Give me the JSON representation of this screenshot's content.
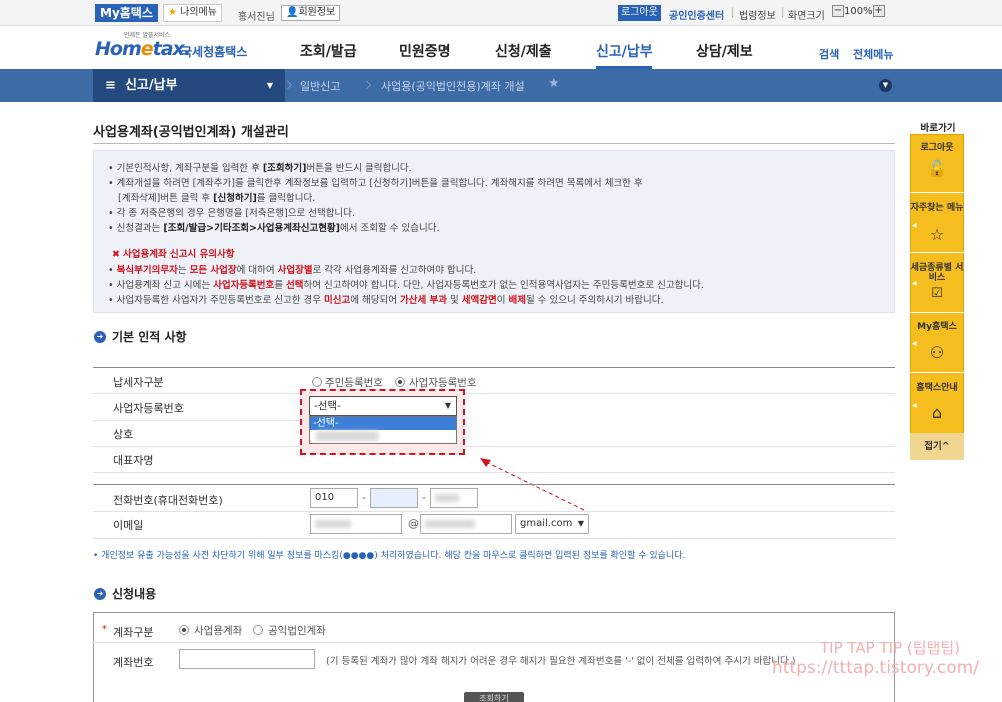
{
  "topbar": {
    "my_hometax": "My홈택스",
    "my_menu": "나의메뉴",
    "user_name": "홍서진님",
    "user_info": "회원정보",
    "logout": "로그아웃",
    "cert_center": "공인인증센터",
    "law_info": "법령정보",
    "screen_size": "화면크기",
    "zoom": "100%"
  },
  "header": {
    "logo_sub": "언제든 알뜰서비스",
    "logo_main": "Hom",
    "logo_e": "e",
    "logo_tax": "tax.",
    "logo_nts": "국세청홈택스",
    "gnav": [
      "조회/발급",
      "민원증명",
      "신청/제출",
      "신고/납부",
      "상담/제보"
    ],
    "search": "검색",
    "all_menu": "전체메뉴"
  },
  "nav": {
    "section": "신고/납부",
    "crumbs": [
      "일반신고",
      "사업용(공익법인전용)계좌 개설"
    ]
  },
  "page": {
    "title": "사업용계좌(공익법인계좌) 개설관리"
  },
  "notice": {
    "l1a": "기본인적사항, 계좌구분을 입력한 후 ",
    "l1b": "[조회하기]",
    "l1c": "버튼을 반드시 클릭합니다.",
    "l2": "계좌개설을 하려면 [계좌추가]를 클릭한후 계좌정보를 입력하고 [신청하기]버튼을 클릭합니다. 계좌해지를 하려면 목록에서 체크한 후",
    "l3a": "[계좌삭제]버튼 클릭 후 ",
    "l3b": "[신청하기]",
    "l3c": "를 클릭합니다.",
    "l4": "각 종 저축은행의 경우 은행명을 [저축은행]으로 선택합니다.",
    "l5a": "신청결과는 ",
    "l5b": "[조회/발급>기타조회>사업용계좌신고현황]",
    "l5c": "에서 조회할 수 있습니다.",
    "w_title": "사업용계좌 신고시 유의사항",
    "w1a": "복식부기의무자",
    "w1b": "는 ",
    "w1c": "모든 사업장",
    "w1d": "에 대하여 ",
    "w1e": "사업장별",
    "w1f": "로 각각 사업용계좌를 신고하여야 합니다.",
    "w2a": "사업용계좌 신고 시에는 ",
    "w2b": "사업자등록번호",
    "w2c": "를 ",
    "w2d": "선택",
    "w2e": "하여 신고하여야 합니다. 다만, 사업자등록번호가 없는 인적용역사업자는 주민등록번호로 신고합니다.",
    "w3a": "사업자등록한 사업자가 주민등록번호로 신고한 경우 ",
    "w3b": "미신고",
    "w3c": "에 해당되어 ",
    "w3d": "가산세 부과",
    "w3e": " 및 ",
    "w3f": "세액감면",
    "w3g": "이 ",
    "w3h": "배제",
    "w3i": "될 수 있으니 주의하시기 바랍니다."
  },
  "basic": {
    "title": "기본 인적 사항",
    "taxpayer_type_label": "납세자구분",
    "opt_resident": "주민등록번호",
    "opt_business": "사업자등록번호",
    "bizno_label": "사업자등록번호",
    "bizno_selected": "-선택-",
    "bizno_options": [
      "-선택-"
    ],
    "company_label": "상호",
    "ceo_label": "대표자명",
    "phone_label": "전화번호(휴대전화번호)",
    "phone1": "010",
    "dash": "-",
    "email_label": "이메일",
    "at": "@",
    "email_domain": "gmail.com",
    "mask_note": "• 개인정보 유출 가능성을 사전 차단하기 위해 일부 정보를 마스킹(●●●●) 처리하였습니다. 해당 칸을 마우스로 클릭하면 입력된 정보를 확인할 수 있습니다."
  },
  "apply": {
    "title": "신청내용",
    "acct_type_label": "계좌구분",
    "opt_business": "사업용계좌",
    "opt_public": "공익법인계좌",
    "acct_no_label": "계좌번호",
    "acct_no_note": "(기 등록된 계좌가 많아 계좌 해지가 어려운 경우 해지가 필요한 계좌번호를 '-' 없이 전체를 입력하여 주시기 바랍니다.)",
    "query_button": "조회하기"
  },
  "quick": {
    "title": "바로가기",
    "items": [
      "로그아웃",
      "자주찾는 메뉴",
      "세금종류별 서비스",
      "My홈택스",
      "홈택스안내"
    ],
    "close": "접기^"
  },
  "watermark": {
    "line1": "TIP TAP TIP (팁탭팁)",
    "line2": "https://tttap.tistory.com/"
  }
}
